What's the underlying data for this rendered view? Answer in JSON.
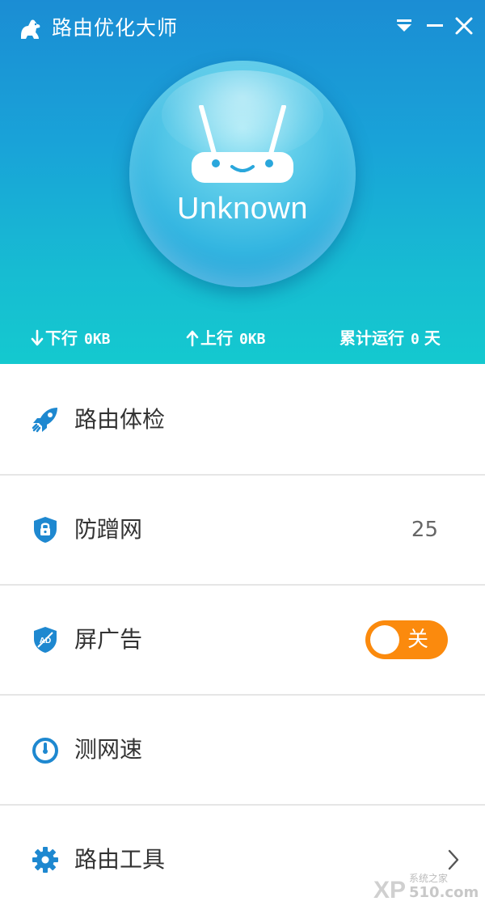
{
  "app": {
    "title": "路由优化大师",
    "logo_icon": "dog-logo-icon"
  },
  "window_controls": {
    "menu_icon": "dropdown-menu-icon",
    "minimize_icon": "minimize-icon",
    "close_icon": "close-icon"
  },
  "status": {
    "router_icon": "smiling-router-icon",
    "text": "Unknown"
  },
  "stats": {
    "download_label": "下行",
    "download_value": "0KB",
    "upload_label": "上行",
    "upload_value": "0KB",
    "uptime_label": "累计运行",
    "uptime_value": "0",
    "uptime_unit": "天"
  },
  "menu": {
    "items": [
      {
        "label": "路由体检",
        "icon": "rocket-icon"
      },
      {
        "label": "防蹭网",
        "icon": "shield-lock-icon",
        "value": "25"
      },
      {
        "label": "屏广告",
        "icon": "shield-ad-icon",
        "toggle_label": "关",
        "toggle_on": false
      },
      {
        "label": "测网速",
        "icon": "speedometer-icon"
      },
      {
        "label": "路由工具",
        "icon": "gear-icon",
        "chevron_icon": "chevron-right-icon"
      }
    ]
  },
  "watermark": {
    "brand": "XP",
    "tagline": "系统之家",
    "site": "510.com"
  },
  "colors": {
    "header_top": "#1b8dd4",
    "header_bottom": "#14c9cf",
    "icon_blue": "#1e88d0",
    "toggle_orange": "#fb8a0d",
    "text_dark": "#333333",
    "divider": "#e6e6e6"
  }
}
